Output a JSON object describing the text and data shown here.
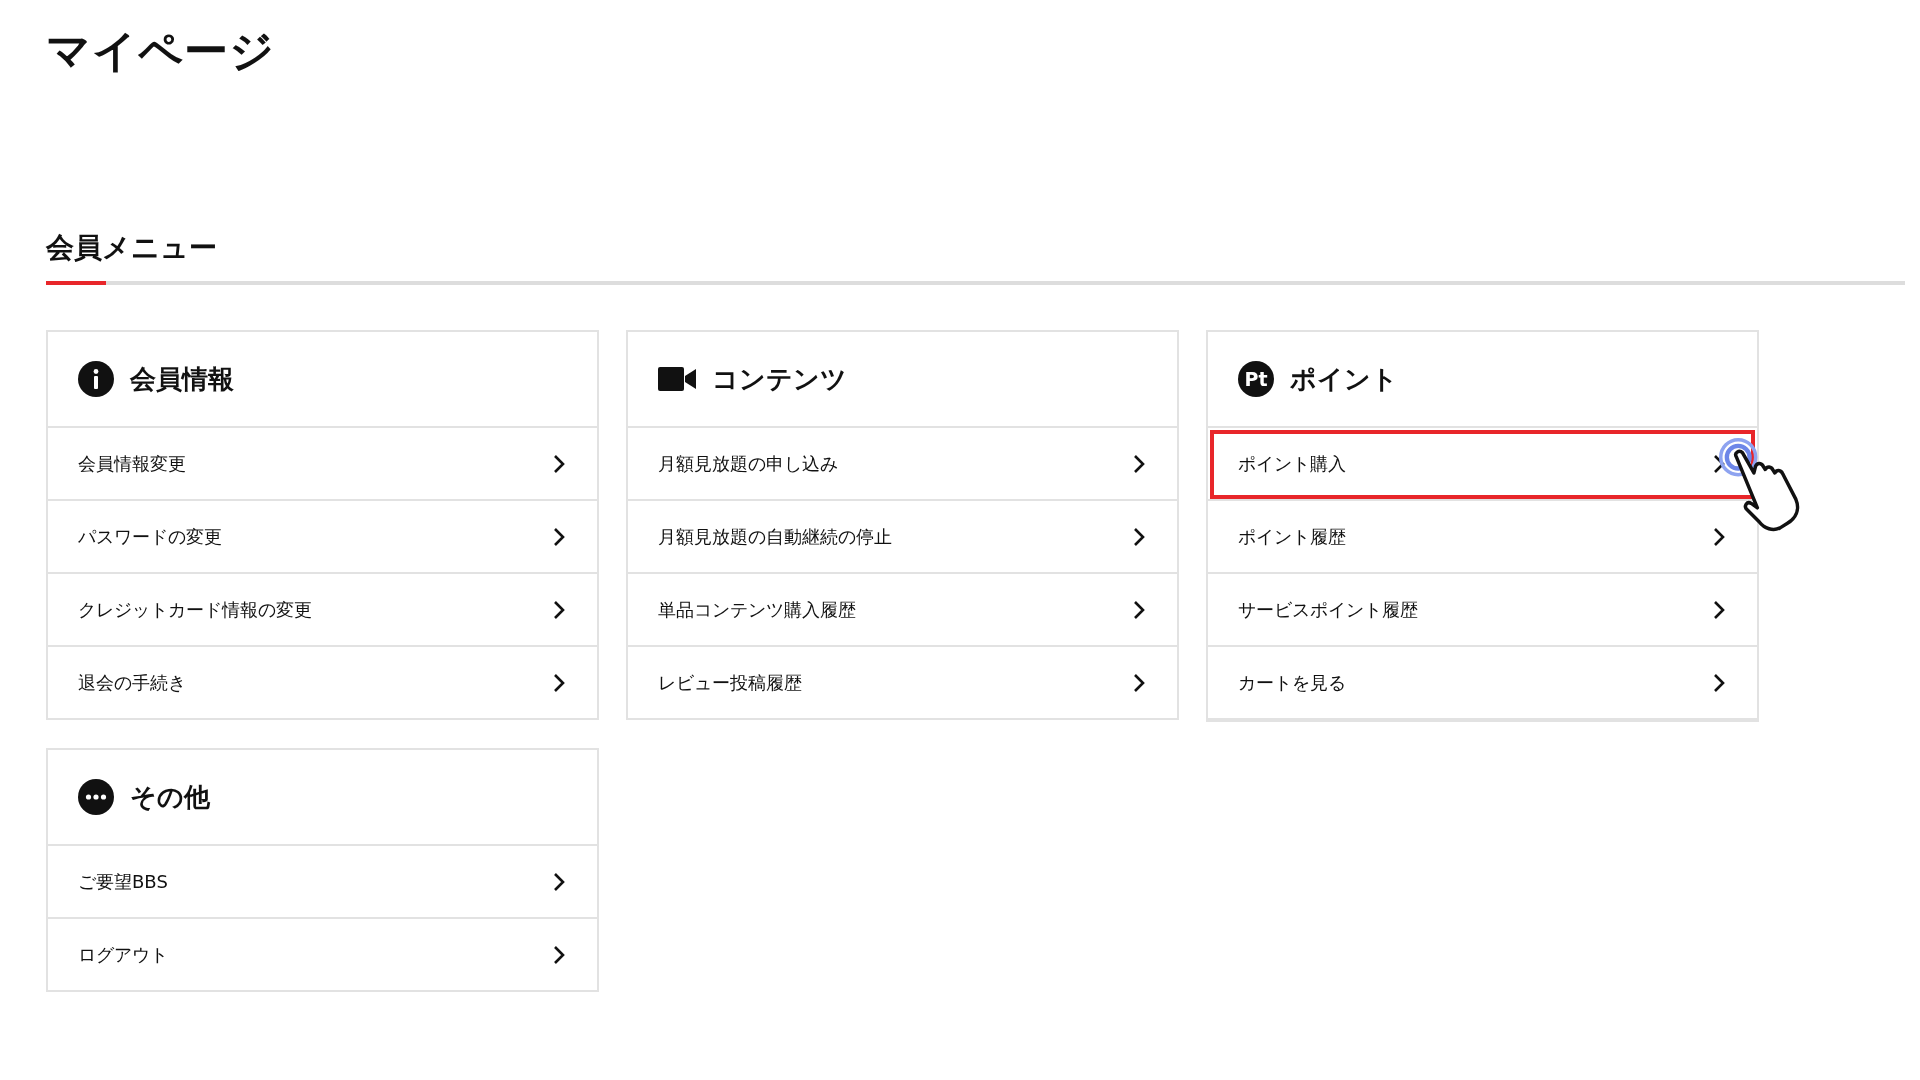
{
  "page_title": "マイページ",
  "section": {
    "title": "会員メニュー"
  },
  "cards": [
    {
      "kind": "info",
      "title": "会員情報",
      "items": [
        {
          "label": "会員情報変更",
          "highlighted": false
        },
        {
          "label": "パスワードの変更",
          "highlighted": false
        },
        {
          "label": "クレジットカード情報の変更",
          "highlighted": false
        },
        {
          "label": "退会の手続き",
          "highlighted": false
        }
      ]
    },
    {
      "kind": "video",
      "title": "コンテンツ",
      "items": [
        {
          "label": "月額見放題の申し込み",
          "highlighted": false
        },
        {
          "label": "月額見放題の自動継続の停止",
          "highlighted": false
        },
        {
          "label": "単品コンテンツ購入履歴",
          "highlighted": false
        },
        {
          "label": "レビュー投稿履歴",
          "highlighted": false
        }
      ]
    },
    {
      "kind": "points",
      "title": "ポイント",
      "badge": "Pt",
      "items": [
        {
          "label": "ポイント購入",
          "highlighted": true
        },
        {
          "label": "ポイント履歴",
          "highlighted": false
        },
        {
          "label": "サービスポイント履歴",
          "highlighted": false
        },
        {
          "label": "カートを見る",
          "highlighted": false
        }
      ]
    },
    {
      "kind": "more",
      "title": "その他",
      "items": [
        {
          "label": "ご要望BBS",
          "highlighted": false
        },
        {
          "label": "ログアウト",
          "highlighted": false
        }
      ]
    }
  ]
}
